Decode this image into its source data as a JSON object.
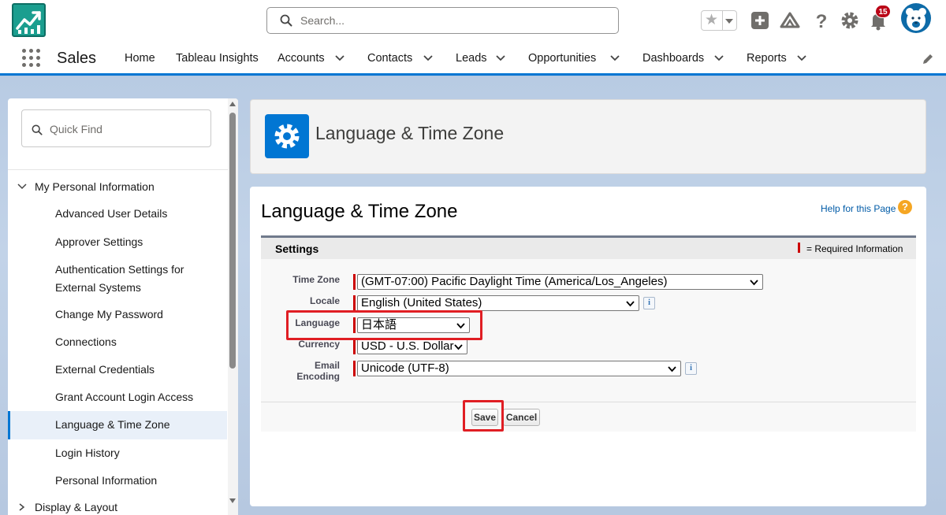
{
  "header": {
    "search_placeholder": "Search...",
    "notification_count": "15"
  },
  "nav": {
    "app_name": "Sales",
    "tabs": [
      {
        "label": "Home"
      },
      {
        "label": "Tableau Insights"
      },
      {
        "label": "Accounts"
      },
      {
        "label": "Contacts"
      },
      {
        "label": "Leads"
      },
      {
        "label": "Opportunities"
      },
      {
        "label": "Dashboards"
      },
      {
        "label": "Reports"
      }
    ]
  },
  "sidebar": {
    "quick_find_placeholder": "Quick Find",
    "section": "My Personal Information",
    "items": [
      {
        "label": "Advanced User Details"
      },
      {
        "label": "Approver Settings"
      },
      {
        "label": "Authentication Settings for External Systems"
      },
      {
        "label": "Change My Password"
      },
      {
        "label": "Connections"
      },
      {
        "label": "External Credentials"
      },
      {
        "label": "Grant Account Login Access"
      },
      {
        "label": "Language & Time Zone"
      },
      {
        "label": "Login History"
      },
      {
        "label": "Personal Information"
      }
    ],
    "next_section": "Display & Layout"
  },
  "page": {
    "header_title": "Language & Time Zone",
    "title": "Language & Time Zone",
    "help_link": "Help for this Page",
    "settings_heading": "Settings",
    "required_info": "= Required Information"
  },
  "form": {
    "time_zone": {
      "label": "Time Zone",
      "value": "(GMT-07:00) Pacific Daylight Time (America/Los_Angeles)"
    },
    "locale": {
      "label": "Locale",
      "value": "English (United States)"
    },
    "language": {
      "label": "Language",
      "value": "日本語"
    },
    "currency": {
      "label": "Currency",
      "value": "USD - U.S. Dollar"
    },
    "email_encoding": {
      "label_line1": "Email",
      "label_line2": "Encoding",
      "value": "Unicode (UTF-8)"
    }
  },
  "buttons": {
    "save": "Save",
    "cancel": "Cancel"
  },
  "colors": {
    "brand": "#0176d3",
    "required": "#cc0000",
    "highlight": "#e01e24"
  }
}
